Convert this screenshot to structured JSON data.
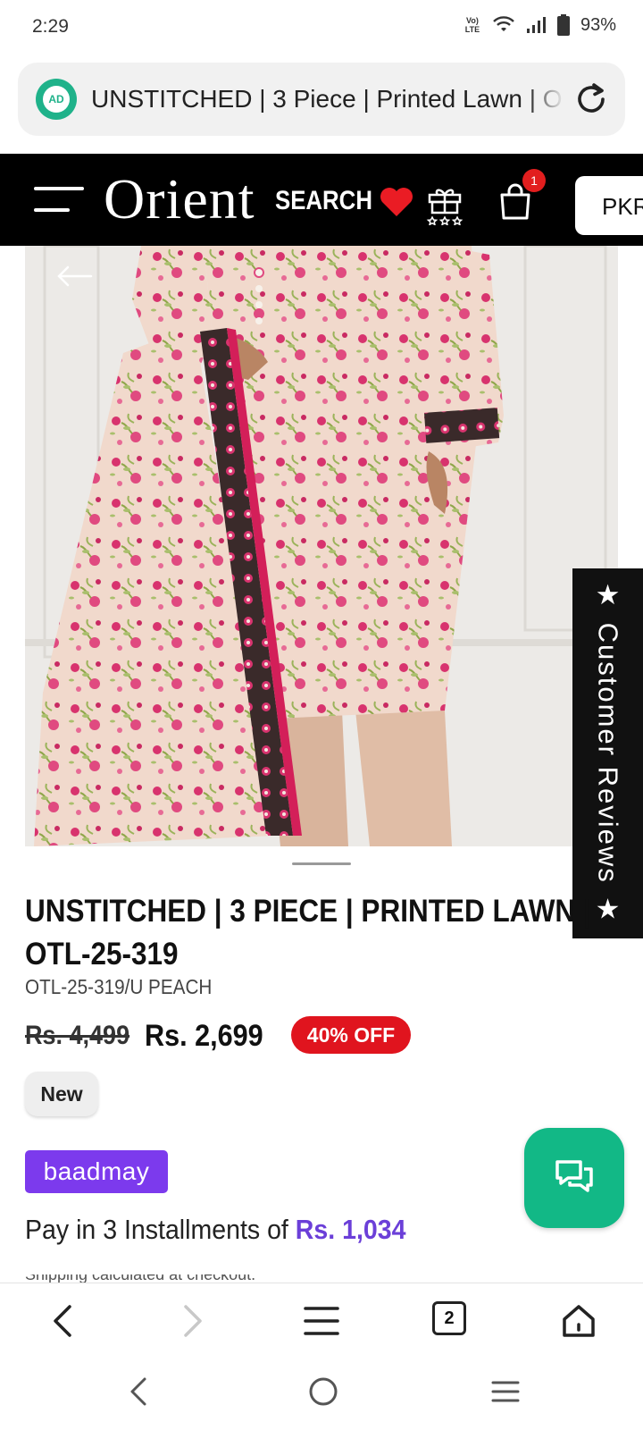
{
  "status_bar": {
    "time": "2:29",
    "network": "Vo) LTE",
    "battery": "93%"
  },
  "browser": {
    "url_title": "UNSTITCHED | 3 Piece | Printed Lawn | O",
    "ad_label": "AD",
    "tab_count": "2"
  },
  "header": {
    "brand": "Orient",
    "search_label": "SEARCH",
    "cart_count": "1",
    "currency": "PKR"
  },
  "reviews_tab": {
    "label": "★ Customer Reviews ★"
  },
  "product": {
    "title_line1": "UNSTITCHED | 3 PIECE | PRINTED LAWN |",
    "title_line2": "OTL-25-319",
    "sku": "OTL-25-319/U PEACH",
    "old_price": "Rs. 4,499",
    "new_price": "Rs. 2,699",
    "discount": "40% OFF",
    "badge": "New"
  },
  "payment": {
    "provider": "baadmay",
    "installment_text": "Pay in 3 Installments of",
    "installment_amount": "Rs. 1,034",
    "cut_off_text": "Shipping calculated at checkout."
  },
  "colors": {
    "header_bg": "#000000",
    "discount_red": "#e0141e",
    "baadmay_purple": "#7c3aed",
    "chat_green": "#12b886",
    "ad_green": "#1fb28a"
  }
}
